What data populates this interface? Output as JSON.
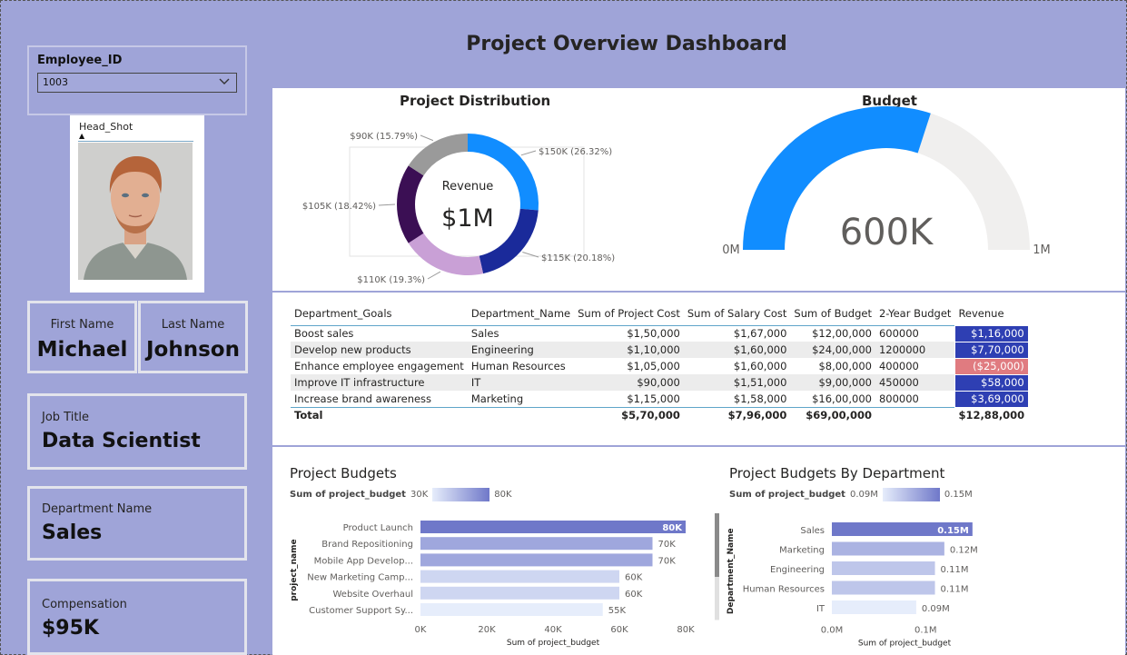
{
  "title": "Project Overview Dashboard",
  "colors": {
    "background": "#9fa4d8",
    "accent_blue": "#118dff",
    "dark_blue": "#1a2a9a",
    "purple_dark": "#3b0f54",
    "lilac": "#c9a0d6",
    "gray": "#9a9a9a",
    "negative": "#e07b80",
    "bar": "#7b82cf"
  },
  "slicer": {
    "label": "Employee_ID",
    "value": "1003"
  },
  "photo": {
    "label": "Head_Shot"
  },
  "employee": {
    "first_name_label": "First Name",
    "first_name": "Michael",
    "last_name_label": "Last Name",
    "last_name": "Johnson",
    "job_title_label": "Job Title",
    "job_title": "Data Scientist",
    "department_label": "Department Name",
    "department": "Sales",
    "compensation_label": "Compensation",
    "compensation": "$95K"
  },
  "donut": {
    "title": "Project Distribution",
    "center_label": "Revenue",
    "center_value": "$1M",
    "slices": [
      {
        "label": "$150K (26.32%)",
        "value": 150,
        "color": "#118dff"
      },
      {
        "label": "$115K (20.18%)",
        "value": 115,
        "color": "#1a2a9a"
      },
      {
        "label": "$110K (19.3%)",
        "value": 110,
        "color": "#c9a0d6"
      },
      {
        "label": "$105K (18.42%)",
        "value": 105,
        "color": "#3b0f54"
      },
      {
        "label": "$90K (15.79%)",
        "value": 90,
        "color": "#9a9a9a"
      }
    ]
  },
  "gauge": {
    "title": "Budget",
    "value": 600000,
    "min": 0,
    "max": 1000000,
    "value_label": "600K",
    "min_label": "0M",
    "max_label": "1M"
  },
  "table": {
    "columns": [
      "Department_Goals",
      "Department_Name",
      "Sum of Project Cost",
      "Sum of Salary Cost",
      "Sum of Budget",
      "2-Year Budget",
      "Revenue"
    ],
    "rows": [
      [
        "Boost sales",
        "Sales",
        "$1,50,000",
        "$1,67,000",
        "$12,00,000",
        "600000",
        "$1,16,000"
      ],
      [
        "Develop new products",
        "Engineering",
        "$1,10,000",
        "$1,60,000",
        "$24,00,000",
        "1200000",
        "$7,70,000"
      ],
      [
        "Enhance employee engagement",
        "Human Resources",
        "$1,05,000",
        "$1,60,000",
        "$8,00,000",
        "400000",
        "($25,000)"
      ],
      [
        "Improve IT infrastructure",
        "IT",
        "$90,000",
        "$1,51,000",
        "$9,00,000",
        "450000",
        "$58,000"
      ],
      [
        "Increase brand awareness",
        "Marketing",
        "$1,15,000",
        "$1,58,000",
        "$16,00,000",
        "800000",
        "$3,69,000"
      ]
    ],
    "revenue_colors": [
      "#2e3fb3",
      "#2e3fb3",
      "#e07b80",
      "#2e3fb3",
      "#2e3fb3"
    ],
    "total": [
      "Total",
      "",
      "$5,70,000",
      "$7,96,000",
      "$69,00,000",
      "",
      "$12,88,000"
    ]
  },
  "chart_data": [
    {
      "type": "bar",
      "title": "Project Budgets",
      "legend_label": "Sum of project_budget",
      "legend_min": "30K",
      "legend_max": "80K",
      "categories": [
        "Product Launch",
        "Brand Repositioning",
        "Mobile App Develop...",
        "New Marketing Camp...",
        "Website Overhaul",
        "Customer Support Sy..."
      ],
      "values": [
        80,
        70,
        70,
        60,
        60,
        55
      ],
      "data_labels": [
        "80K",
        "70K",
        "70K",
        "60K",
        "60K",
        "55K"
      ],
      "ticks": [
        "0K",
        "20K",
        "40K",
        "60K",
        "80K"
      ],
      "xlim": [
        0,
        80
      ],
      "xlabel": "Sum of project_budget",
      "ylabel": "project_name"
    },
    {
      "type": "bar",
      "title": "Project Budgets By Department",
      "legend_label": "Sum of project_budget",
      "legend_min": "0.09M",
      "legend_max": "0.15M",
      "categories": [
        "Sales",
        "Marketing",
        "Engineering",
        "Human Resources",
        "IT"
      ],
      "values": [
        0.15,
        0.12,
        0.11,
        0.11,
        0.09
      ],
      "data_labels": [
        "0.15M",
        "0.12M",
        "0.11M",
        "0.11M",
        "0.09M"
      ],
      "ticks": [
        "0.0M",
        "0.1M"
      ],
      "xlim": [
        0,
        0.155
      ],
      "xlabel": "Sum of project_budget",
      "ylabel": "Department_Name"
    }
  ]
}
